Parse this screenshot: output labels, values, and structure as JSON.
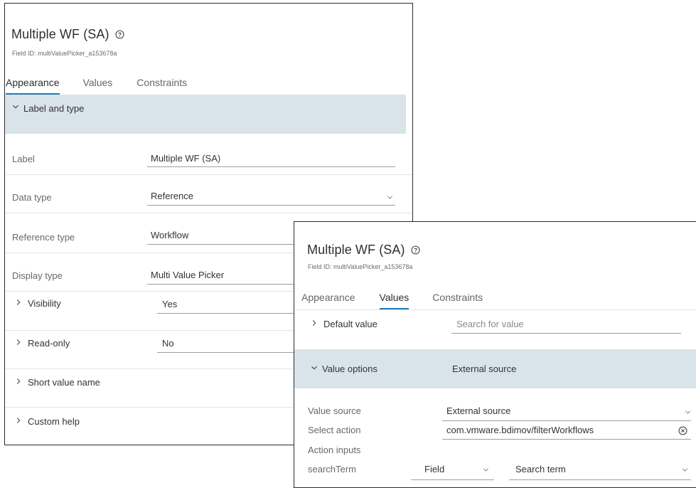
{
  "left_panel": {
    "title": "Multiple WF (SA)",
    "field_id": "Field ID: multiValuePicker_a153678a",
    "tabs": [
      {
        "label": "Appearance",
        "active": true
      },
      {
        "label": "Values",
        "active": false
      },
      {
        "label": "Constraints",
        "active": false
      }
    ],
    "section": {
      "label": "Label and type",
      "expanded": true
    },
    "fields": {
      "label": {
        "label": "Label",
        "value": "Multiple WF (SA)"
      },
      "data_type": {
        "label": "Data type",
        "value": "Reference"
      },
      "reference_type": {
        "label": "Reference type",
        "value": "Workflow"
      },
      "display_type": {
        "label": "Display type",
        "value": "Multi Value Picker"
      }
    },
    "collapsed_sections": [
      {
        "label": "Visibility",
        "value": "Yes"
      },
      {
        "label": "Read-only",
        "value": "No"
      },
      {
        "label": "Short value name",
        "value": ""
      },
      {
        "label": "Custom help",
        "value": ""
      }
    ]
  },
  "right_panel": {
    "title": "Multiple WF (SA)",
    "field_id": "Field ID: multiValuePicker_a153678a",
    "tabs": [
      {
        "label": "Appearance",
        "active": false
      },
      {
        "label": "Values",
        "active": true
      },
      {
        "label": "Constraints",
        "active": false
      }
    ],
    "default_value": {
      "label": "Default value",
      "placeholder": "Search for value"
    },
    "value_options": {
      "label": "Value options",
      "summary": "External source",
      "expanded": true
    },
    "value_source": {
      "label": "Value source",
      "value": "External source"
    },
    "select_action": {
      "label": "Select action",
      "value": "com.vmware.bdimov/filterWorkflows"
    },
    "action_inputs": {
      "label": "Action inputs"
    },
    "search_term": {
      "label": "searchTerm",
      "type_value": "Field",
      "placeholder": "Search term"
    }
  },
  "colors": {
    "section_bg": "#d9e3ea",
    "tab_accent": "#1f79b8",
    "border": "#2b2b2b"
  },
  "icons": [
    "help-circle-icon",
    "chevron-down-icon",
    "chevron-right-icon",
    "clear-circle-icon"
  ]
}
